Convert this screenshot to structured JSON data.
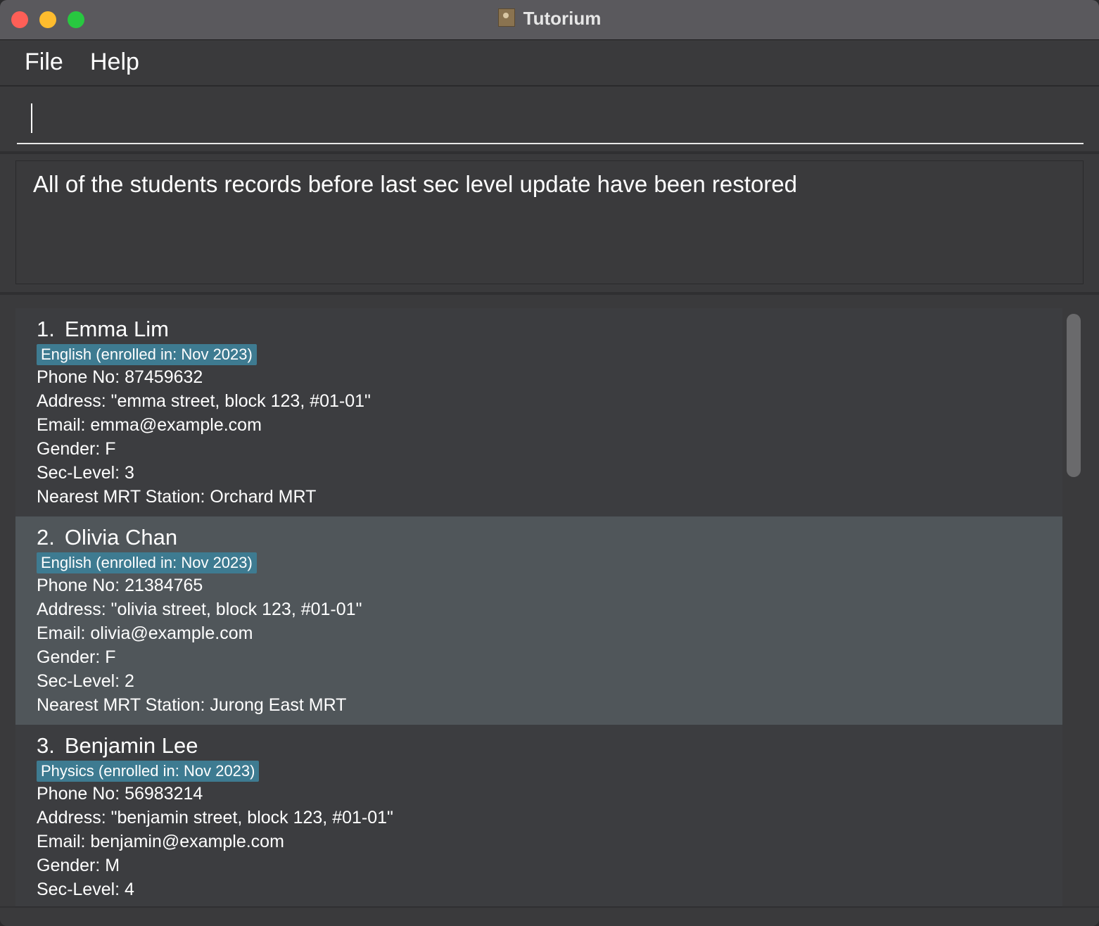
{
  "window": {
    "title": "Tutorium"
  },
  "menu": {
    "file": "File",
    "help": "Help"
  },
  "command": {
    "value": ""
  },
  "result": {
    "message": "All of the students records before last sec level update have been restored"
  },
  "students": [
    {
      "index": "1.",
      "name": "Emma Lim",
      "tag": "English (enrolled in: Nov 2023)",
      "phone": "Phone No: 87459632",
      "address": "Address: \"emma street,  block 123,  #01-01\"",
      "email": "Email: emma@example.com",
      "gender": "Gender: F",
      "sec_level": "Sec-Level: 3",
      "mrt": "Nearest MRT Station: Orchard MRT"
    },
    {
      "index": "2.",
      "name": "Olivia Chan",
      "tag": "English (enrolled in: Nov 2023)",
      "phone": "Phone No: 21384765",
      "address": "Address: \"olivia street,  block 123,  #01-01\"",
      "email": "Email: olivia@example.com",
      "gender": "Gender: F",
      "sec_level": "Sec-Level: 2",
      "mrt": "Nearest MRT Station: Jurong East MRT"
    },
    {
      "index": "3.",
      "name": "Benjamin Lee",
      "tag": "Physics (enrolled in: Nov 2023)",
      "phone": "Phone No: 56983214",
      "address": "Address: \"benjamin street,  block 123,  #01-01\"",
      "email": "Email: benjamin@example.com",
      "gender": "Gender: M",
      "sec_level": "Sec-Level: 4"
    }
  ],
  "icons": {
    "app": "person-card-icon"
  }
}
